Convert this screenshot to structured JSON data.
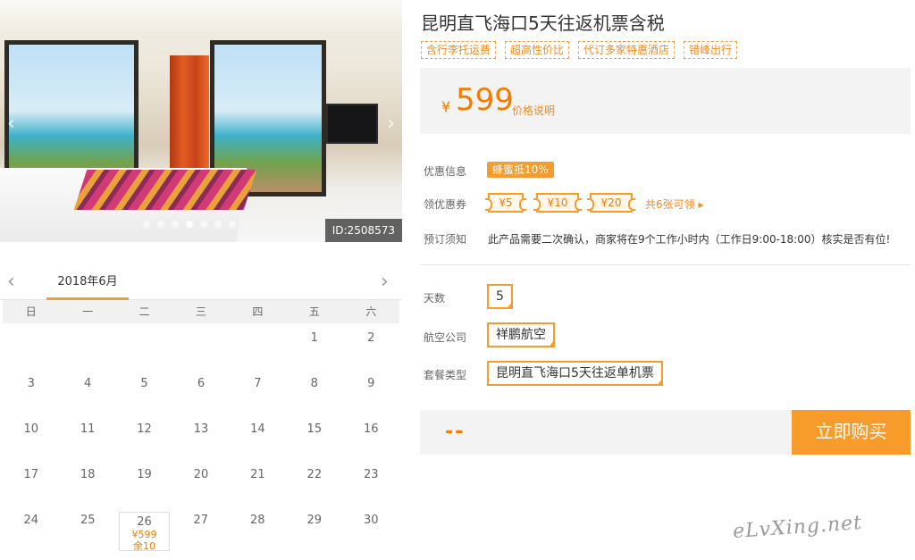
{
  "gallery": {
    "image_id": "ID:2508573",
    "prev_icon": "chevron-left-icon",
    "next_icon": "chevron-right-icon",
    "slide_count": 7,
    "active_slide": 4
  },
  "product": {
    "title": "昆明直飞海口5天往返机票含税",
    "tags": [
      "含行李托运费",
      "超高性价比",
      "代订多家特惠酒店",
      "错峰出行"
    ],
    "currency": "¥",
    "price": "599",
    "price_explain": "价格说明"
  },
  "info": {
    "promo_label": "优惠信息",
    "promo_badge": "蜂蜜抵10%",
    "coupon_label": "领优惠券",
    "coupons": [
      "¥5",
      "¥10",
      "¥20"
    ],
    "coupon_more": "共6张可领 ▸",
    "notice_label": "预订须知",
    "notice_text": "此产品需要二次确认，商家将在9个工作小时内（工作日9:00-18:00）核实是否有位!"
  },
  "options": {
    "days_label": "天数",
    "days_value": "5",
    "airline_label": "航空公司",
    "airline_value": "祥鹏航空",
    "package_label": "套餐类型",
    "package_value": "昆明直飞海口5天往返单机票"
  },
  "buy": {
    "total": "--",
    "button": "立即购买"
  },
  "calendar": {
    "month": "2018年6月",
    "prev_icon": "chevron-left-icon",
    "next_icon": "chevron-right-icon",
    "weekdays": [
      "日",
      "一",
      "二",
      "三",
      "四",
      "五",
      "六"
    ],
    "rows": [
      [
        "",
        "",
        "",
        "",
        "",
        "1",
        "2"
      ],
      [
        "3",
        "4",
        "5",
        "6",
        "7",
        "8",
        "9"
      ],
      [
        "10",
        "11",
        "12",
        "13",
        "14",
        "15",
        "16"
      ],
      [
        "17",
        "18",
        "19",
        "20",
        "21",
        "22",
        "23"
      ],
      [
        "24",
        "25",
        "26",
        "27",
        "28",
        "29",
        "30"
      ]
    ],
    "special": {
      "day": "26",
      "price": "¥599",
      "stock": "余10"
    }
  },
  "watermark": "eLvXing.net",
  "colors": {
    "accent": "#f79b2a",
    "price": "#f57b00"
  }
}
